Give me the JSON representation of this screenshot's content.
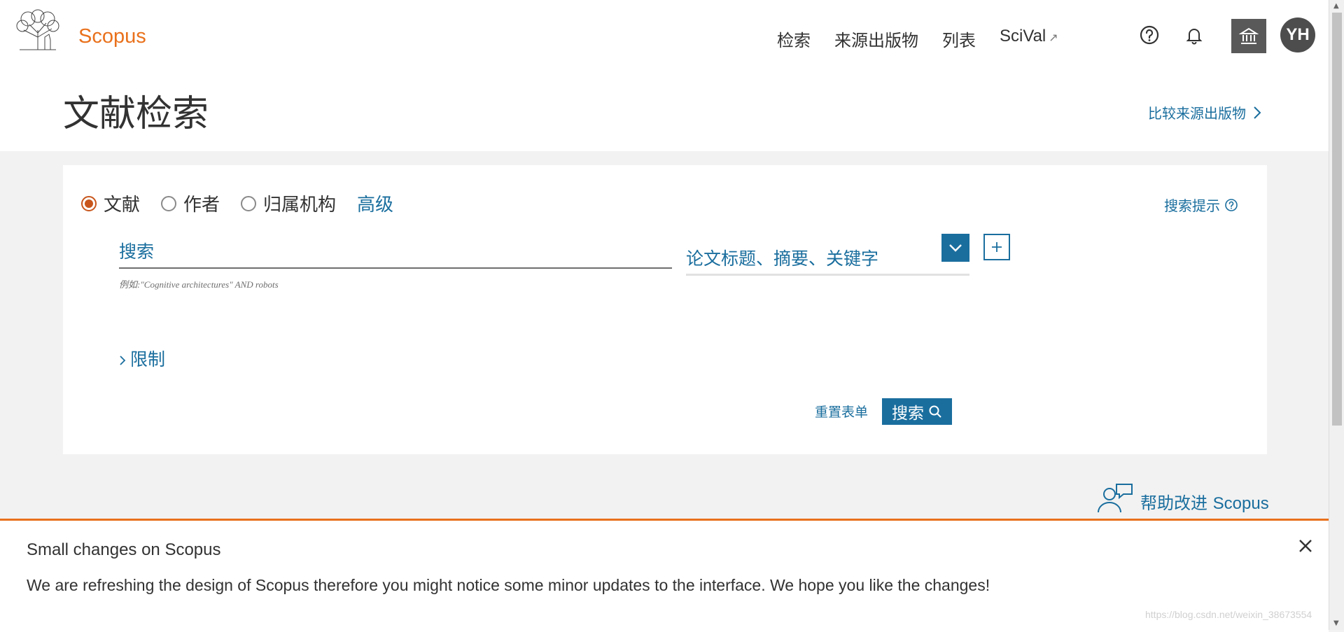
{
  "header": {
    "brand": "Scopus",
    "nav": [
      {
        "label": "检索"
      },
      {
        "label": "来源出版物"
      },
      {
        "label": "列表"
      },
      {
        "label": "SciVal",
        "external_icon": "↗"
      }
    ],
    "avatar_initials": "YH"
  },
  "page": {
    "title": "文献检索",
    "compare_link": "比较来源出版物"
  },
  "search_form": {
    "modes": [
      {
        "label": "文献",
        "selected": true
      },
      {
        "label": "作者",
        "selected": false
      },
      {
        "label": "归属机构",
        "selected": false
      }
    ],
    "advanced_label": "高级",
    "tips_label": "搜索提示",
    "search_placeholder": "搜索",
    "example_text": "例如:\"Cognitive architectures\" AND robots",
    "field_selected": "论文标题、摘要、关键字",
    "limits_label": "限制",
    "reset_label": "重置表单",
    "search_button_label": "搜索"
  },
  "feedback": {
    "label_cn": "帮助改进",
    "label_en": "Scopus"
  },
  "banner": {
    "title": "Small changes on Scopus",
    "text": "We are refreshing the design of Scopus therefore you might notice some minor updates to the interface. We hope you like the changes!"
  },
  "watermark": "https://blog.csdn.net/weixin_38673554",
  "colors": {
    "brand_orange": "#e9711c",
    "link_blue": "#1a6e9e",
    "radio_selected": "#c8561c"
  }
}
